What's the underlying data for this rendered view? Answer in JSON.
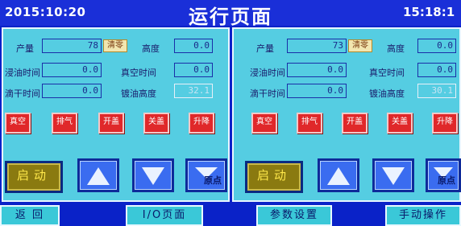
{
  "header": {
    "time_left": "2015:10:20",
    "title": "运行页面",
    "time_right": "15:18:1"
  },
  "panels": [
    {
      "output_label": "产量",
      "output_value": "78",
      "reset_label": "清零",
      "height_label": "高度",
      "height_value": "0.0",
      "soak_time_label": "浸油时间",
      "soak_time_value": "0.0",
      "vacuum_time_label": "真空时间",
      "vacuum_time_value": "0.0",
      "drip_time_label": "滴干时间",
      "drip_time_value": "0.0",
      "oil_height_label": "镀油高度",
      "oil_height_value": "32.1",
      "buttons": [
        "真空",
        "排气",
        "开盖",
        "关盖",
        "升降"
      ],
      "start_label": "启动",
      "origin_label": "原点"
    },
    {
      "output_label": "产量",
      "output_value": "73",
      "reset_label": "清零",
      "height_label": "高度",
      "height_value": "0.0",
      "soak_time_label": "浸油时间",
      "soak_time_value": "0.0",
      "vacuum_time_label": "真空时间",
      "vacuum_time_value": "0.0",
      "drip_time_label": "滴干时间",
      "drip_time_value": "0.0",
      "oil_height_label": "镀油高度",
      "oil_height_value": "30.1",
      "buttons": [
        "真空",
        "排气",
        "开盖",
        "关盖",
        "升降"
      ],
      "start_label": "启动",
      "origin_label": "原点"
    }
  ],
  "nav": {
    "back": "返 回",
    "io_page": "I/O页面",
    "params_page": "参数设置",
    "manual": "手动操作"
  },
  "colors": {
    "background": "#0a22c8",
    "panel": "#55cde2",
    "red_button": "#e0282a",
    "start_button": "#8a7a10",
    "arrow_button": "#3a6cf0"
  }
}
